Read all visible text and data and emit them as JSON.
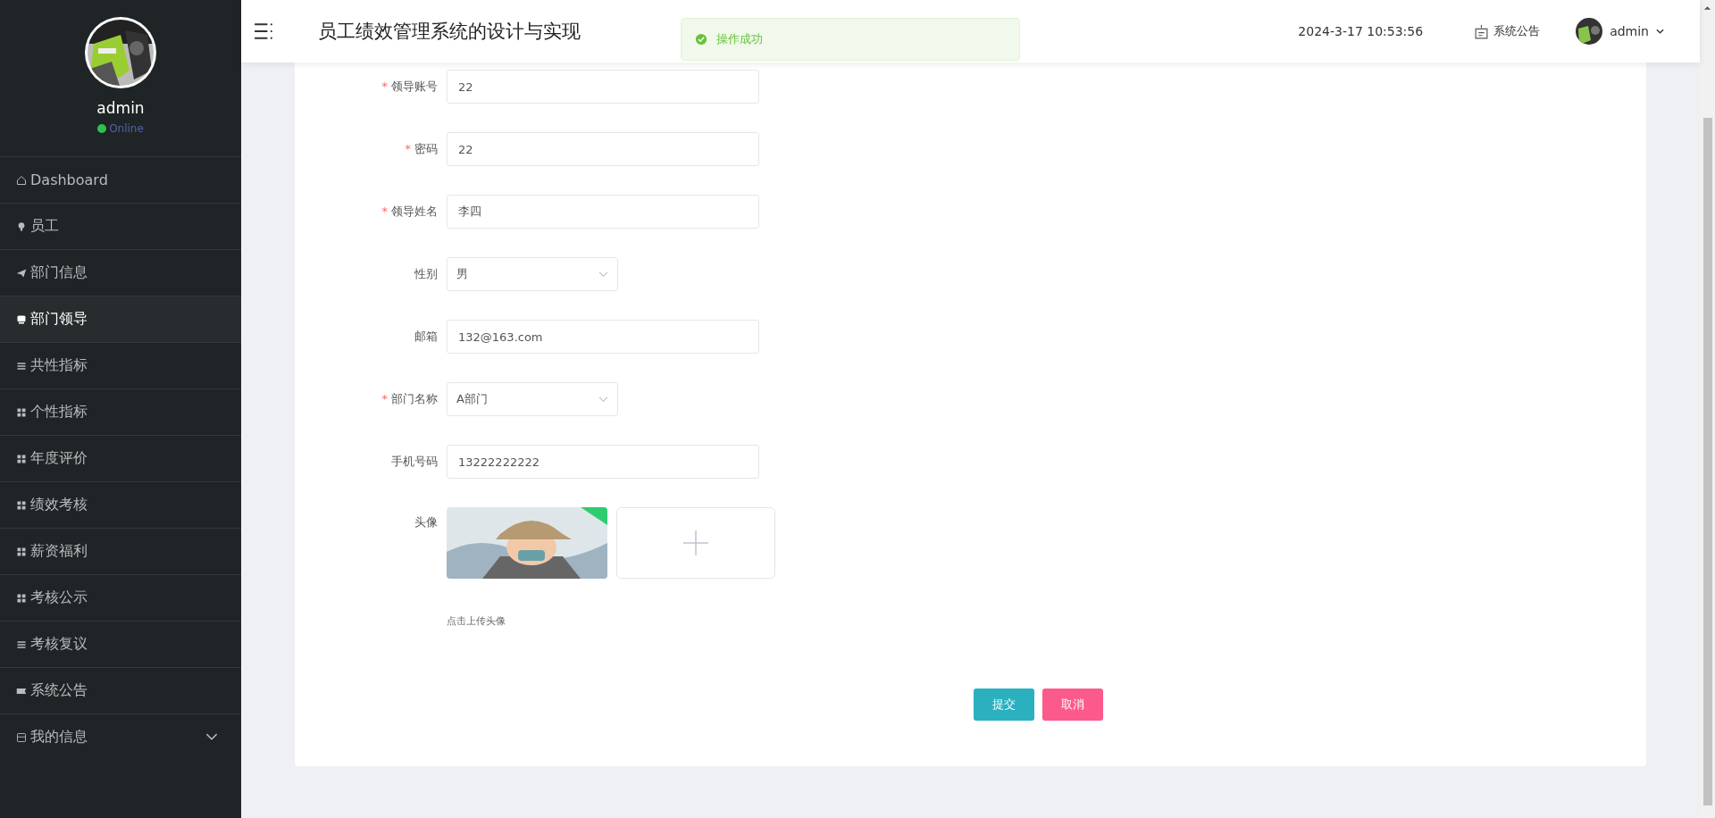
{
  "sidebar": {
    "user": {
      "name": "admin",
      "status": "Online"
    },
    "items": [
      {
        "label": "Dashboard",
        "selected": false,
        "has_submenu": false
      },
      {
        "label": "员工",
        "selected": false,
        "has_submenu": false
      },
      {
        "label": "部门信息",
        "selected": false,
        "has_submenu": false
      },
      {
        "label": "部门领导",
        "selected": true,
        "has_submenu": false
      },
      {
        "label": "共性指标",
        "selected": false,
        "has_submenu": false
      },
      {
        "label": "个性指标",
        "selected": false,
        "has_submenu": false
      },
      {
        "label": "年度评价",
        "selected": false,
        "has_submenu": false
      },
      {
        "label": "绩效考核",
        "selected": false,
        "has_submenu": false
      },
      {
        "label": "薪资福利",
        "selected": false,
        "has_submenu": false
      },
      {
        "label": "考核公示",
        "selected": false,
        "has_submenu": false
      },
      {
        "label": "考核复议",
        "selected": false,
        "has_submenu": false
      },
      {
        "label": "系统公告",
        "selected": false,
        "has_submenu": false
      },
      {
        "label": "我的信息",
        "selected": false,
        "has_submenu": true
      }
    ]
  },
  "header": {
    "title": "员工绩效管理系统的设计与实现",
    "datetime": "2024-3-17 10:53:56",
    "notice": "系统公告",
    "user": "admin"
  },
  "toast": {
    "kind": "success",
    "text": "操作成功"
  },
  "form": {
    "fields": [
      {
        "kind": "input",
        "required_mark": "*",
        "label": "领导账号",
        "value": "22"
      },
      {
        "kind": "input",
        "required_mark": "*",
        "label": "密码",
        "value": "22"
      },
      {
        "kind": "input",
        "required_mark": "*",
        "label": "领导姓名",
        "value": "李四"
      },
      {
        "kind": "select",
        "label": "性别",
        "value": "男"
      },
      {
        "kind": "input",
        "label": "邮箱",
        "value": "132@163.com"
      },
      {
        "kind": "select",
        "required_mark": "*",
        "label": "部门名称",
        "value": "A部门"
      },
      {
        "kind": "input",
        "label": "手机号码",
        "value": "13222222222"
      },
      {
        "kind": "upload",
        "label": "头像",
        "hint": "点击上传头像"
      }
    ],
    "buttons": [
      {
        "kind": "primary",
        "label": "提交"
      },
      {
        "kind": "danger",
        "label": "取消"
      }
    ]
  }
}
